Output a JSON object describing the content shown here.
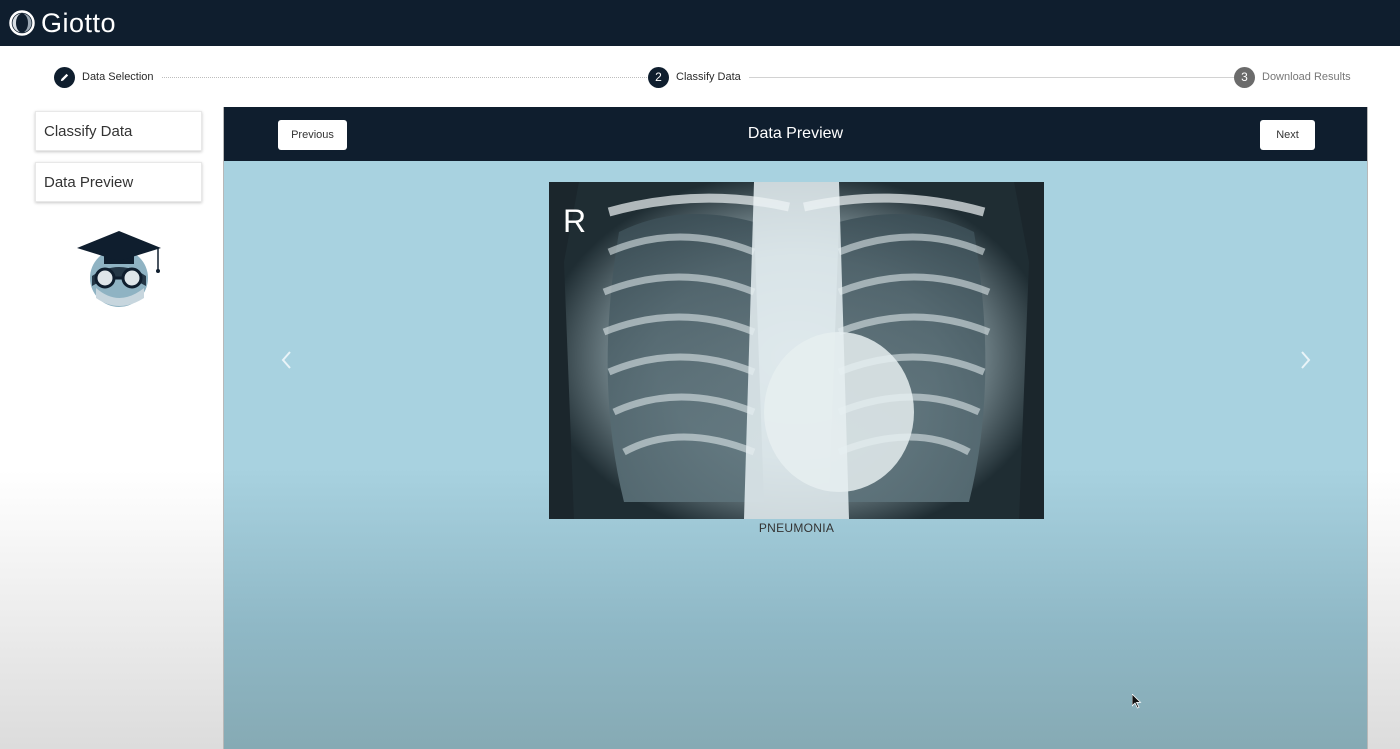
{
  "app": {
    "name": "Giotto"
  },
  "stepper": {
    "steps": [
      {
        "number": "1",
        "label": "Data Selection",
        "state": "done"
      },
      {
        "number": "2",
        "label": "Classify Data",
        "state": "active"
      },
      {
        "number": "3",
        "label": "Download Results",
        "state": "pending"
      }
    ]
  },
  "sidebar": {
    "items": [
      {
        "label": "Classify Data"
      },
      {
        "label": "Data Preview"
      }
    ]
  },
  "panel": {
    "title": "Data Preview",
    "previous_label": "Previous",
    "next_label": "Next"
  },
  "preview": {
    "marker": "R",
    "label": "PNEUMONIA"
  },
  "icons": {
    "logo": "giotto-logo-icon",
    "step_done": "pencil-icon",
    "prev_slide": "chevron-left-icon",
    "next_slide": "chevron-right-icon",
    "mascot": "graduate-mascot-icon"
  },
  "colors": {
    "navy": "#0f1e2e",
    "panel_bg": "#a8d2e0",
    "inactive_step": "#6b6b6b"
  }
}
